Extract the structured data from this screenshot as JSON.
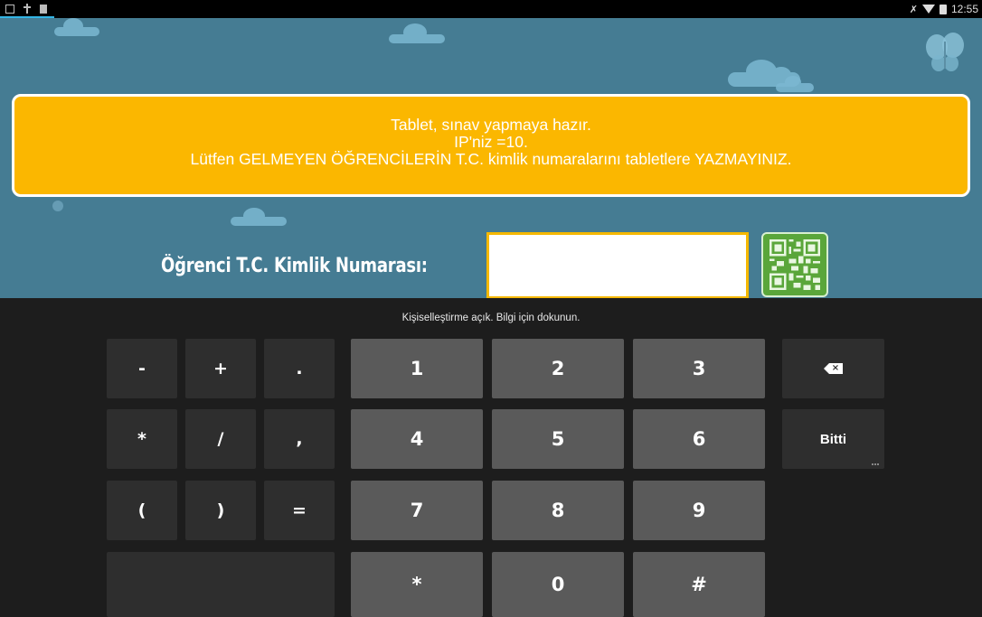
{
  "status_bar": {
    "time": "12:55",
    "left_icons": [
      "image-icon",
      "usb-icon",
      "signal-bars-icon"
    ],
    "right_icons": [
      "mute-icon",
      "wifi-icon",
      "battery-icon"
    ]
  },
  "notice": {
    "line1": "Tablet, sınav yapmaya hazır.",
    "line2": "IP'niz =10.",
    "line3": "Lütfen GELMEYEN ÖĞRENCİLERİN T.C. kimlik numaralarını tabletlere YAZMAYINIZ."
  },
  "form": {
    "label": "Öğrenci T.C. Kimlik Numarası:",
    "input_value": "",
    "qr_button_icon": "qr-code-icon"
  },
  "keyboard": {
    "hint": "Kişiselleştirme açık. Bilgi için dokunun.",
    "symbol_keys": [
      "-",
      "+",
      ".",
      "*",
      "/",
      ",",
      "(",
      ")",
      "="
    ],
    "digit_keys": [
      "1",
      "2",
      "3",
      "4",
      "5",
      "6",
      "7",
      "8",
      "9",
      "*",
      "0",
      "#"
    ],
    "backspace_icon": "backspace-icon",
    "done_label": "Bitti"
  },
  "colors": {
    "background": "#457c93",
    "notice": "#fbb700",
    "input_border": "#f5b800",
    "qr_button": "#5aa63a",
    "keyboard": "#1d1d1d"
  }
}
